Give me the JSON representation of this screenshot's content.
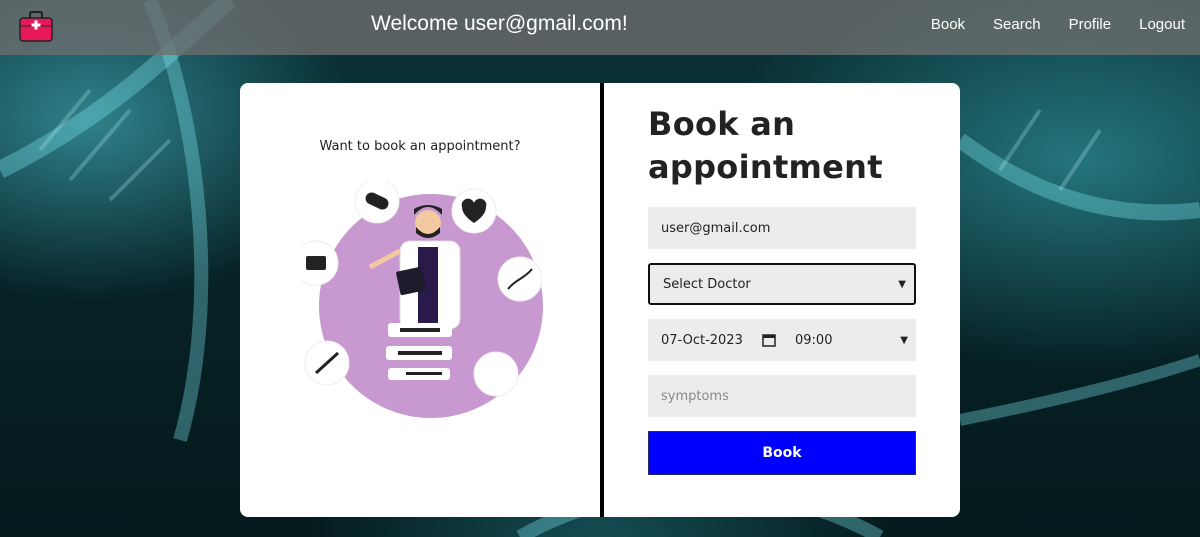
{
  "navbar": {
    "welcome_text": "Welcome user@gmail.com!",
    "links": [
      "Book",
      "Search",
      "Profile",
      "Logout"
    ]
  },
  "left_panel": {
    "prompt": "Want to book an appointment?"
  },
  "form": {
    "title_line1": "Book an",
    "title_line2": "appointment",
    "email_value": "user@gmail.com",
    "doctor_select_value": "Select Doctor",
    "date_value": "07-Oct-2023",
    "time_value": "09:00",
    "symptoms_placeholder": "symptoms",
    "submit_label": "Book"
  },
  "colors": {
    "accent": "#0000ff",
    "logo": "#e8185a",
    "illustration_circle": "#c898d0"
  },
  "icons": [
    "medical-bag-icon",
    "calendar-icon",
    "chevron-down-icon"
  ]
}
